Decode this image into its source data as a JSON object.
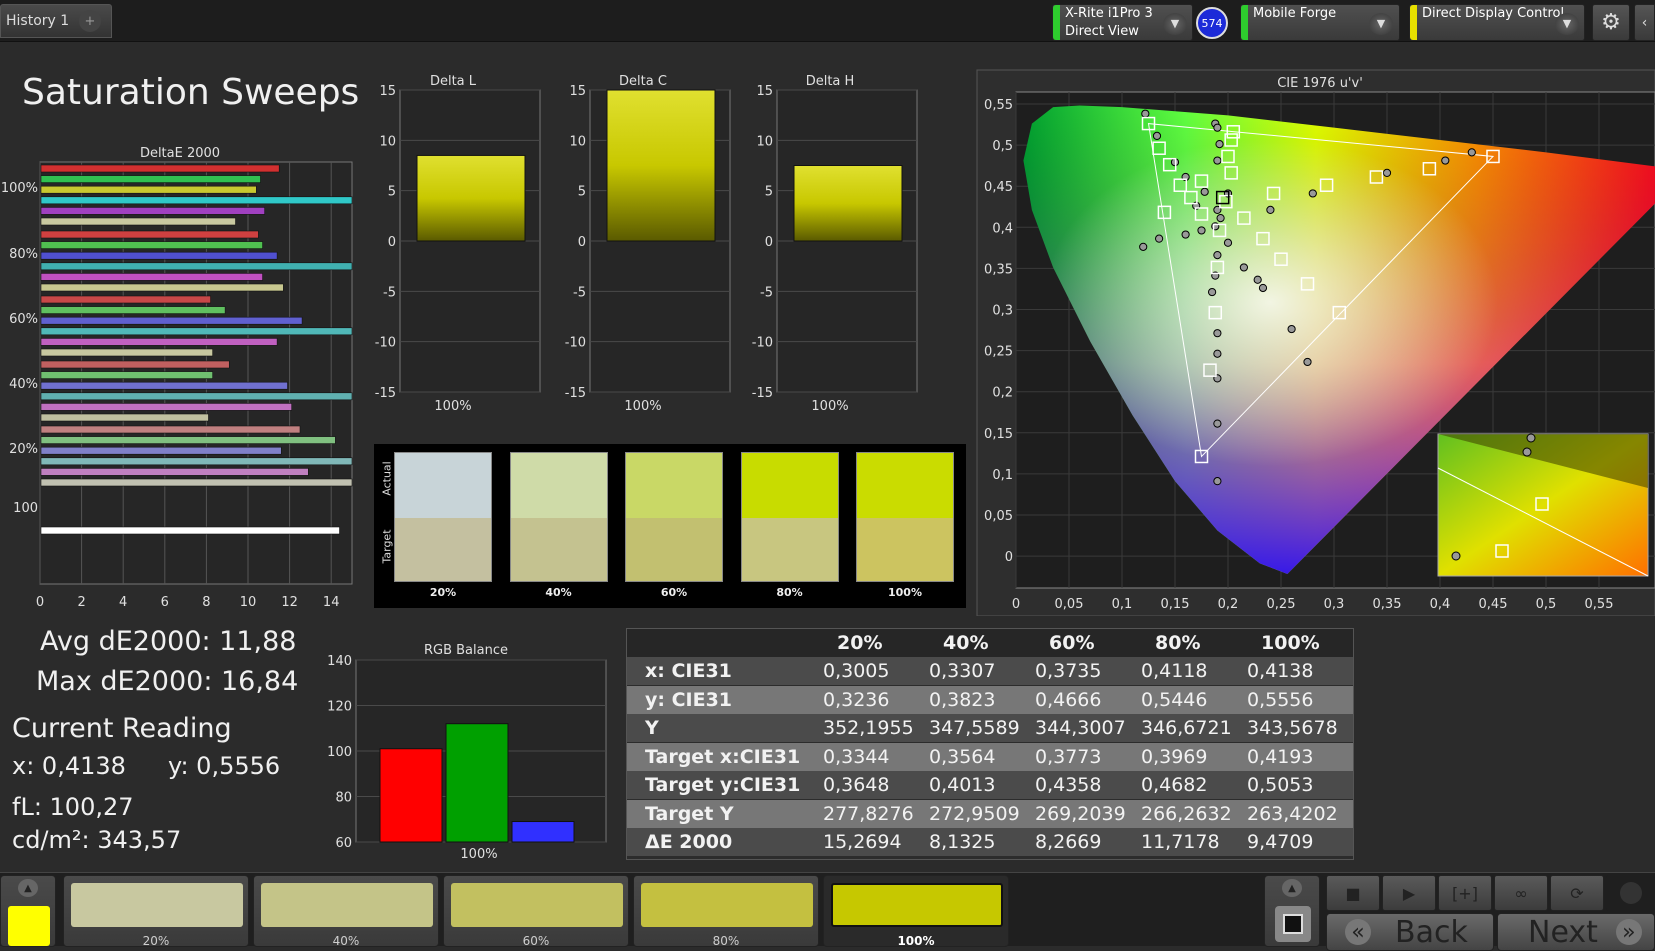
{
  "tabs": {
    "history": "History 1",
    "add": "+"
  },
  "devices": [
    {
      "line1": "X-Rite i1Pro 3",
      "line2": "Direct View",
      "stripe": "#2ecc2e"
    },
    {
      "line1": "Mobile Forge",
      "line2": "",
      "stripe": "#2ecc2e"
    },
    {
      "line1": "Direct Display Control",
      "line2": "",
      "stripe": "#e8e000"
    }
  ],
  "badge": "574",
  "page_title": "Saturation Sweeps",
  "colors": {
    "accent_yellow": "#c8d200",
    "red": "#ff0000",
    "green": "#00a000",
    "blue": "#3030ff"
  },
  "deltae_chart": {
    "title": "DeltaE 2000",
    "group_labels": [
      "100%",
      "80%",
      "60%",
      "40%",
      "20%",
      "100"
    ],
    "x_ticks": [
      "0",
      "2",
      "4",
      "6",
      "8",
      "10",
      "12",
      "14"
    ],
    "xlim": [
      0,
      15
    ]
  },
  "chart_data": [
    {
      "type": "bar",
      "title": "Delta L",
      "categories": [
        "100%"
      ],
      "values": [
        8.5
      ],
      "ylim": [
        -15,
        15
      ],
      "yticks": [
        "15",
        "10",
        "5",
        "0",
        "-5",
        "-10",
        "-15"
      ]
    },
    {
      "type": "bar",
      "title": "Delta C",
      "categories": [
        "100%"
      ],
      "values": [
        15
      ],
      "ylim": [
        -15,
        15
      ],
      "yticks": [
        "15",
        "10",
        "5",
        "0",
        "-5",
        "-10",
        "-15"
      ]
    },
    {
      "type": "bar",
      "title": "Delta H",
      "categories": [
        "100%"
      ],
      "values": [
        7.5
      ],
      "ylim": [
        -15,
        15
      ],
      "yticks": [
        "15",
        "10",
        "5",
        "0",
        "-5",
        "-10",
        "-15"
      ]
    },
    {
      "type": "bar",
      "title": "RGB Balance",
      "categories": [
        "R",
        "G",
        "B"
      ],
      "values": [
        101,
        112,
        69
      ],
      "colors": [
        "#ff0000",
        "#00a000",
        "#3030ff"
      ],
      "ylim": [
        60,
        140
      ],
      "yticks": [
        "140",
        "120",
        "100",
        "80",
        "60"
      ],
      "xlabel": "100%"
    },
    {
      "type": "bar",
      "title": "DeltaE 2000",
      "orientation": "horizontal",
      "groups": [
        {
          "label": "100%",
          "values": [
            11.5,
            10.6,
            10.4,
            15,
            10.8,
            9.4
          ],
          "colors": [
            "#d23030",
            "#30c050",
            "#c8c830",
            "#30c8c8",
            "#a040c0",
            "#c8c8a0"
          ]
        },
        {
          "label": "80%",
          "values": [
            10.5,
            10.7,
            11.4,
            15,
            10.7,
            11.7
          ],
          "colors": [
            "#d04040",
            "#50c050",
            "#5050d0",
            "#40b0b0",
            "#c050c0",
            "#c8c890"
          ]
        },
        {
          "label": "60%",
          "values": [
            8.2,
            8.9,
            12.6,
            15,
            11.4,
            8.3
          ],
          "colors": [
            "#c84848",
            "#60c060",
            "#6060d0",
            "#50b8b8",
            "#c060c0",
            "#c8c8a0"
          ]
        },
        {
          "label": "40%",
          "values": [
            9.1,
            8.3,
            11.9,
            15,
            12.1,
            8.1
          ],
          "colors": [
            "#c06060",
            "#70c070",
            "#7070d0",
            "#60b0b0",
            "#c070c0",
            "#c0c0a0"
          ]
        },
        {
          "label": "20%",
          "values": [
            12.5,
            14.2,
            11.6,
            15,
            12.9,
            15
          ],
          "colors": [
            "#c08080",
            "#80c080",
            "#8080c8",
            "#80b8b8",
            "#c080c0",
            "#c0c0b0"
          ]
        },
        {
          "label": "100",
          "values": [
            14.4
          ],
          "colors": [
            "#ffffff"
          ]
        }
      ]
    },
    {
      "type": "table",
      "columns": [
        "",
        "20%",
        "40%",
        "60%",
        "80%",
        "100%"
      ],
      "rows": [
        [
          "x: CIE31",
          "0,3005",
          "0,3307",
          "0,3735",
          "0,4118",
          "0,4138"
        ],
        [
          "y: CIE31",
          "0,3236",
          "0,3823",
          "0,4666",
          "0,5446",
          "0,5556"
        ],
        [
          "Y",
          "352,1955",
          "347,5589",
          "344,3007",
          "346,6721",
          "343,5678"
        ],
        [
          "Target x:CIE31",
          "0,3344",
          "0,3564",
          "0,3773",
          "0,3969",
          "0,4193"
        ],
        [
          "Target y:CIE31",
          "0,3648",
          "0,4013",
          "0,4358",
          "0,4682",
          "0,5053"
        ],
        [
          "Target Y",
          "277,8276",
          "272,9509",
          "269,2039",
          "266,2632",
          "263,4202"
        ],
        [
          "ΔE 2000",
          "15,2694",
          "8,1325",
          "8,2669",
          "11,7178",
          "9,4709"
        ]
      ]
    },
    {
      "type": "scatter",
      "title": "CIE 1976 u'v'",
      "xlim": [
        0,
        0.6
      ],
      "ylim": [
        0,
        0.6
      ],
      "xticks": [
        "0",
        "0,05",
        "0,1",
        "0,15",
        "0,2",
        "0,25",
        "0,3",
        "0,35",
        "0,4",
        "0,45",
        "0,5",
        "0,55"
      ],
      "yticks": [
        "0,55",
        "0,5",
        "0,45",
        "0,4",
        "0,35",
        "0,3",
        "0,25",
        "0,2",
        "0,15",
        "0,1",
        "0,05",
        "0"
      ],
      "targets": [
        [
          0.125,
          0.565
        ],
        [
          0.135,
          0.535
        ],
        [
          0.145,
          0.515
        ],
        [
          0.155,
          0.49
        ],
        [
          0.165,
          0.475
        ],
        [
          0.175,
          0.455
        ],
        [
          0.14,
          0.457
        ],
        [
          0.175,
          0.495
        ],
        [
          0.2,
          0.525
        ],
        [
          0.203,
          0.545
        ],
        [
          0.205,
          0.555
        ],
        [
          0.203,
          0.505
        ],
        [
          0.198,
          0.47
        ],
        [
          0.192,
          0.435
        ],
        [
          0.19,
          0.39
        ],
        [
          0.188,
          0.335
        ],
        [
          0.183,
          0.265
        ],
        [
          0.175,
          0.16
        ],
        [
          0.215,
          0.45
        ],
        [
          0.233,
          0.425
        ],
        [
          0.25,
          0.4
        ],
        [
          0.275,
          0.37
        ],
        [
          0.305,
          0.335
        ],
        [
          0.243,
          0.48
        ],
        [
          0.293,
          0.49
        ],
        [
          0.34,
          0.5
        ],
        [
          0.39,
          0.51
        ],
        [
          0.45,
          0.525
        ],
        [
          0.195,
          0.475
        ]
      ],
      "measured": [
        [
          0.122,
          0.577
        ],
        [
          0.133,
          0.55
        ],
        [
          0.15,
          0.518
        ],
        [
          0.16,
          0.5
        ],
        [
          0.178,
          0.482
        ],
        [
          0.19,
          0.46
        ],
        [
          0.17,
          0.465
        ],
        [
          0.12,
          0.415
        ],
        [
          0.135,
          0.425
        ],
        [
          0.16,
          0.43
        ],
        [
          0.175,
          0.435
        ],
        [
          0.188,
          0.44
        ],
        [
          0.193,
          0.45
        ],
        [
          0.188,
          0.565
        ],
        [
          0.19,
          0.56
        ],
        [
          0.192,
          0.54
        ],
        [
          0.19,
          0.52
        ],
        [
          0.2,
          0.48
        ],
        [
          0.2,
          0.42
        ],
        [
          0.19,
          0.405
        ],
        [
          0.188,
          0.38
        ],
        [
          0.185,
          0.36
        ],
        [
          0.19,
          0.31
        ],
        [
          0.19,
          0.285
        ],
        [
          0.19,
          0.255
        ],
        [
          0.19,
          0.2
        ],
        [
          0.19,
          0.13
        ],
        [
          0.215,
          0.39
        ],
        [
          0.228,
          0.375
        ],
        [
          0.233,
          0.365
        ],
        [
          0.24,
          0.46
        ],
        [
          0.26,
          0.315
        ],
        [
          0.275,
          0.275
        ],
        [
          0.28,
          0.48
        ],
        [
          0.35,
          0.505
        ],
        [
          0.405,
          0.52
        ],
        [
          0.43,
          0.53
        ]
      ]
    },
    {
      "type": "table",
      "title": "Actual / Target",
      "columns": [
        "20%",
        "40%",
        "60%",
        "80%",
        "100%"
      ],
      "actual": [
        "#c8d4d8",
        "#cfdba8",
        "#c9d866",
        "#c8dc00",
        "#cadc00"
      ],
      "target": [
        "#c4c0a0",
        "#c4c290",
        "#c2c070",
        "#c8c680",
        "#ccc460"
      ]
    }
  ],
  "swatch_panel": {
    "actual_label": "Actual",
    "target_label": "Target",
    "labels": [
      "20%",
      "40%",
      "60%",
      "80%",
      "100%"
    ]
  },
  "stats": {
    "avg": "Avg dE2000: 11,88",
    "max": "Max dE2000: 16,84"
  },
  "reading": {
    "title": "Current Reading",
    "x": "x: 0,4138",
    "y": "y: 0,5556",
    "fl": "fL: 100,27",
    "cdm2": "cd/m²: 343,57"
  },
  "bottom": {
    "swatches": [
      {
        "label": "20%",
        "color": "#c8c8a0"
      },
      {
        "label": "40%",
        "color": "#c4c488"
      },
      {
        "label": "60%",
        "color": "#c2c060"
      },
      {
        "label": "80%",
        "color": "#c4c040"
      },
      {
        "label": "100%",
        "color": "#c6c800"
      }
    ],
    "current_color": "#ffff00",
    "back": "Back",
    "next": "Next"
  }
}
